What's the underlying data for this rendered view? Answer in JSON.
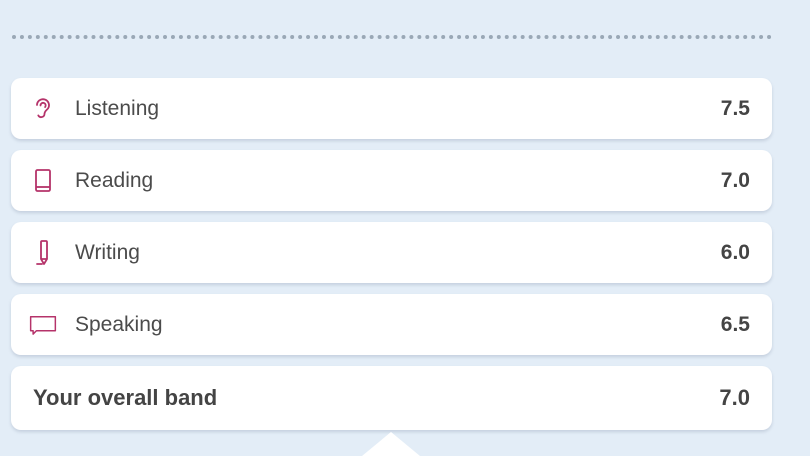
{
  "skills": [
    {
      "label": "Listening",
      "score": "7.5",
      "icon": "ear-icon"
    },
    {
      "label": "Reading",
      "score": "7.0",
      "icon": "book-icon"
    },
    {
      "label": "Writing",
      "score": "6.0",
      "icon": "pencil-icon"
    },
    {
      "label": "Speaking",
      "score": "6.5",
      "icon": "speech-bubble-icon"
    }
  ],
  "overall": {
    "label": "Your overall band",
    "score": "7.0"
  },
  "colors": {
    "accent": "#b5336a",
    "background": "#e3edf7",
    "card": "#ffffff"
  }
}
